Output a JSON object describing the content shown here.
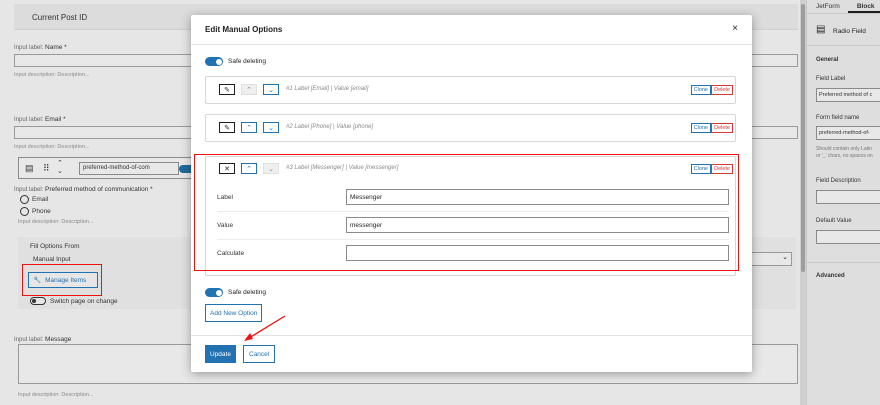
{
  "background": {
    "block_title": "Current Post ID",
    "fields": [
      {
        "label_prefix": "Input label:",
        "label": "Name *",
        "desc_prefix": "Input description:",
        "desc": "Description..."
      },
      {
        "label_prefix": "Input label:",
        "label": "Email *",
        "desc_prefix": "Input description:",
        "desc": "Description..."
      }
    ],
    "toolbar": {
      "field_value": "preferred-method-of-com"
    },
    "radio_field": {
      "label_prefix": "Input label:",
      "label": "Preferred method of communication *",
      "options": [
        "Email",
        "Phone"
      ],
      "desc_prefix": "Input description:",
      "desc": "Description..."
    },
    "fill_options": {
      "label": "Fill Options From",
      "value": "Manual Input"
    },
    "manage_items_label": "Manage Items",
    "switch_page_label": "Switch page on change",
    "message_field": {
      "label_prefix": "Input label:",
      "label": "Message",
      "desc_prefix": "Input description:",
      "desc": "Description..."
    }
  },
  "sidebar": {
    "tabs": [
      "JetForm",
      "Block"
    ],
    "active_tab": "Block",
    "block_name": "Radio Field",
    "general_label": "General",
    "field_label_title": "Field Label",
    "field_label_value": "Preferred method of c",
    "form_field_name_title": "Form field name",
    "form_field_name_value": "preferred-method-of-",
    "help_line1": "Should contain only Latin",
    "help_line2": "or '_' chars, no spaces on",
    "field_desc_title": "Field Description",
    "default_value_title": "Default Value",
    "advanced_label": "Advanced"
  },
  "modal": {
    "title": "Edit Manual Options",
    "close_glyph": "×",
    "safe_deleting_label": "Safe deleting",
    "options": [
      {
        "title": "#1 Label [Email] | Value [email]"
      },
      {
        "title": "#2 Label [Phone] | Value [phone]"
      },
      {
        "title": "#3 Label [Messenger] | Value [messenger]"
      }
    ],
    "clone_label": "Clone",
    "delete_label": "Delete",
    "open_option": {
      "rows": [
        {
          "label": "Label",
          "value": "Messenger"
        },
        {
          "label": "Value",
          "value": "messenger"
        },
        {
          "label": "Calculate",
          "value": ""
        }
      ]
    },
    "add_new_label": "Add New Option",
    "update_label": "Update",
    "cancel_label": "Cancel"
  },
  "colors": {
    "accent": "#2271b1",
    "danger": "#d63638",
    "highlight": "#ee1111"
  }
}
